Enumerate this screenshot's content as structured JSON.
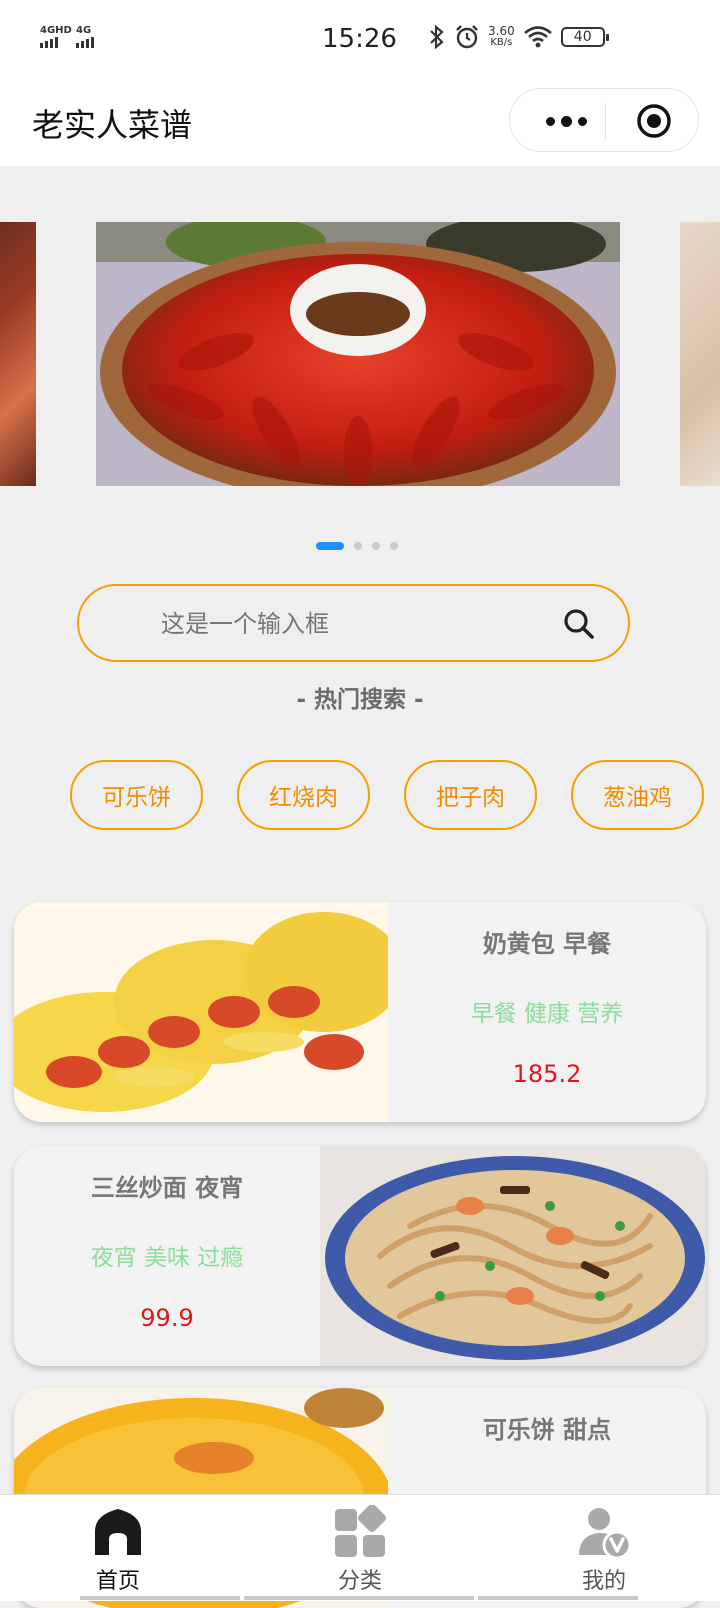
{
  "status_bar": {
    "signal1": "4GHD",
    "signal2": "4G",
    "time": "15:26",
    "speed_value": "3.60",
    "speed_unit": "KB/s",
    "battery": "40"
  },
  "header": {
    "title": "老实人菜谱",
    "menu_icon": "more-dots-icon",
    "close_icon": "target-circle-icon"
  },
  "banner": {
    "slide_count": 4,
    "active_index": 0,
    "active_color": "#1e90ff"
  },
  "search": {
    "placeholder": "这是一个输入框",
    "icon": "search-icon"
  },
  "hot": {
    "title": "- 热门搜索 -",
    "tags": [
      "可乐饼",
      "红烧肉",
      "把子肉",
      "葱油鸡"
    ]
  },
  "recipes": [
    {
      "name": "奶黄包 早餐",
      "tags": "早餐 健康 营养",
      "price": "185.2"
    },
    {
      "name": "三丝炒面 夜宵",
      "tags": "夜宵 美味 过瘾",
      "price": "99.9"
    },
    {
      "name": "可乐饼 甜点",
      "tags": "",
      "price": ""
    }
  ],
  "tabbar": {
    "items": [
      {
        "label": "首页",
        "icon": "home-icon"
      },
      {
        "label": "分类",
        "icon": "category-grid-icon"
      },
      {
        "label": "我的",
        "icon": "user-vip-icon"
      }
    ]
  },
  "colors": {
    "accent": "#f0a000",
    "tag_green": "#8edc9e",
    "price_red": "#e0161a"
  }
}
